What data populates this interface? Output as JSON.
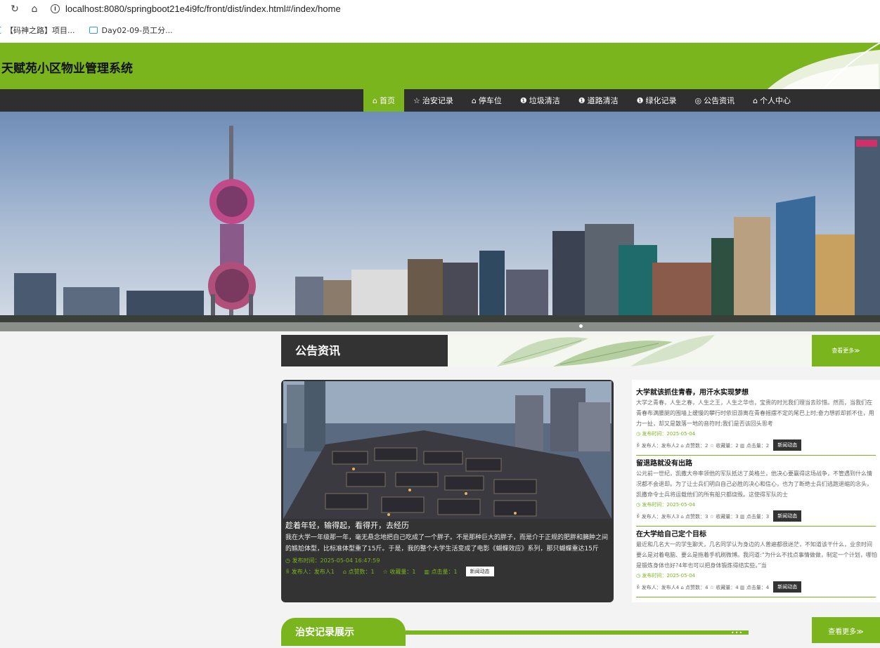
{
  "browser": {
    "url": "localhost:8080/springboot21e4i9fc/front/dist/index.html#/index/home",
    "bookmarks": [
      "【码神之路】项目...",
      "Day02-09-员工分..."
    ]
  },
  "site": {
    "title": "天赋苑小区物业管理系统"
  },
  "nav": [
    {
      "label": "首页",
      "icon": "home-icon",
      "glyph": "⌂",
      "active": true
    },
    {
      "label": "治安记录",
      "icon": "star-icon",
      "glyph": "☆"
    },
    {
      "label": "停车位",
      "icon": "bag-icon",
      "glyph": "⌂"
    },
    {
      "label": "垃圾清洁",
      "icon": "info-icon",
      "glyph": "❶"
    },
    {
      "label": "道路清洁",
      "icon": "info-icon",
      "glyph": "❶"
    },
    {
      "label": "绿化记录",
      "icon": "info-icon",
      "glyph": "❶"
    },
    {
      "label": "公告资讯",
      "icon": "globe-icon",
      "glyph": "◎"
    },
    {
      "label": "个人中心",
      "icon": "home-icon",
      "glyph": "⌂"
    }
  ],
  "notice_section": {
    "title": "公告资讯",
    "more": "查看更多≫",
    "feature": {
      "title": "趁着年轻，输得起，看得开，去经历",
      "desc": "我在大学一年级那一年，毫无悬念地把自己吃成了一个胖子。不是那种巨大的胖子，而是介于正规的肥胖和臃肿之间的尴尬体型，比标准体型重了15斤。于是，我的整个大学生活变成了电影《蝴蝶效应》系列，那只蝴蝶重达15斤",
      "time": "◷ 发布时间：2025-05-04 16:47:59",
      "author": "ꆜ 发布人：发布人1",
      "likes": "⌂ 点赞数：1",
      "favs": "☆ 收藏量：1",
      "clicks": "▥ 点击量：1",
      "tag": "新闻动态"
    },
    "items": [
      {
        "title": "大学就该抓住青春，用汗水实现梦想",
        "desc": "大学之青春，人生之春，人生之王，人生之华也，宝贵的时光我们理当去珍惜。然而，当我们在青春布满腰腿的围墙上缓慢的攀行时依旧游离在青春摇摆不定的尾巴上时;奋力想抓却抓不住，用力一扯，却又是散落一地的音符时;我们是否该回头思考",
        "time": "◷ 发布时间：2025-05-04",
        "stats": "ꆜ 发布人：发布人2  ⌂ 点赞数：2  ☆ 收藏量：2  ▥ 点击量：2",
        "tag": "新闻动态"
      },
      {
        "title": "留退路就没有出路",
        "desc": "公元前一世纪，凯撒大帝率领他的军队抵达了英格兰，他决心要赢得这场战争，不管遇到什么情况都不会退却。为了让士兵们明白自己必胜的决心和信心，也为了断绝士兵们逃跑退缩的念头，凯撒命令士兵将运载他们的所有船只都烧毁。这使得军队的士",
        "time": "◷ 发布时间：2025-05-04",
        "stats": "ꆜ 发布人：发布人3  ⌂ 点赞数：3  ☆ 收藏量：3  ▥ 点击量：3",
        "tag": "新闻动态"
      },
      {
        "title": "在大学给自己定个目标",
        "desc": "最近和几名大一的学生聊天，几名同学认为身边的人普遍都很迷茫，不知道该干什么，业余时间要么是对着电脑、要么是拖着手机刷微博。我问道:“为什么不找点事情做做，制定一个计划，哪怕是锻炼身体也好?4年也可以把身体锻炼得结实些。”当",
        "time": "◷ 发布时间：2025-05-04",
        "stats": "ꆜ 发布人：发布人4  ⌂ 点赞数：4  ☆ 收藏量：4  ▥ 点击量：4",
        "tag": "新闻动态"
      }
    ]
  },
  "security_section": {
    "title": "治安记录展示",
    "dots": "•••",
    "more": "查看更多≫"
  },
  "colors": {
    "accent": "#7ab51d",
    "dark": "#2f2f2f"
  }
}
